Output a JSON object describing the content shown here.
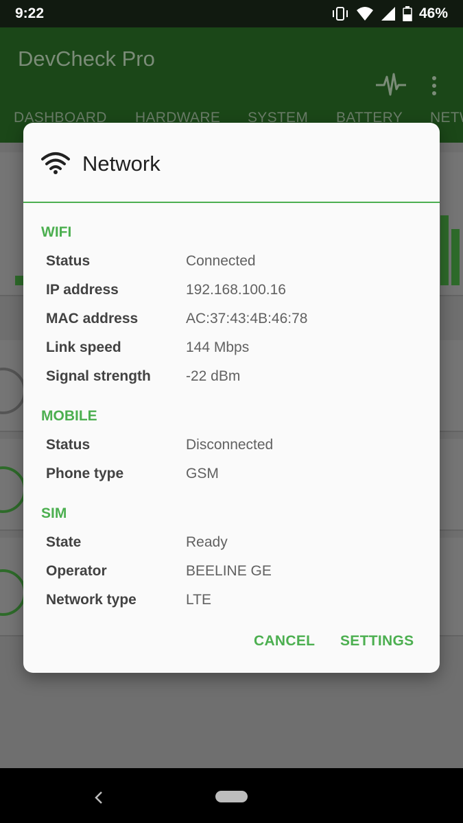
{
  "status_bar": {
    "time": "9:22",
    "battery_percent": "46%",
    "icons": [
      "vibrate-icon",
      "wifi-signal-icon",
      "cell-signal-icon",
      "battery-icon"
    ]
  },
  "app_bar": {
    "title": "DevCheck Pro",
    "icons": [
      "pulse-icon",
      "more-vert-icon"
    ],
    "tabs": [
      "DASHBOARD",
      "HARDWARE",
      "SYSTEM",
      "BATTERY",
      "NETW"
    ]
  },
  "dialog": {
    "title": "Network",
    "icon": "wifi-icon",
    "sections": {
      "wifi": {
        "title": "WIFI",
        "rows": [
          {
            "label": "Status",
            "value": "Connected"
          },
          {
            "label": "IP address",
            "value": "192.168.100.16"
          },
          {
            "label": "MAC address",
            "value": "AC:37:43:4B:46:78"
          },
          {
            "label": "Link speed",
            "value": "144 Mbps"
          },
          {
            "label": "Signal strength",
            "value": "-22 dBm"
          }
        ]
      },
      "mobile": {
        "title": "MOBILE",
        "rows": [
          {
            "label": "Status",
            "value": "Disconnected"
          },
          {
            "label": "Phone type",
            "value": "GSM"
          }
        ]
      },
      "sim": {
        "title": "SIM",
        "rows": [
          {
            "label": "State",
            "value": "Ready"
          },
          {
            "label": "Operator",
            "value": "BEELINE GE"
          },
          {
            "label": "Network type",
            "value": "LTE"
          }
        ]
      }
    },
    "buttons": {
      "cancel": "CANCEL",
      "settings": "SETTINGS"
    }
  },
  "colors": {
    "accent": "#4caf50",
    "app_bar": "#2e7d32",
    "dialog_bg": "#fafafa"
  }
}
